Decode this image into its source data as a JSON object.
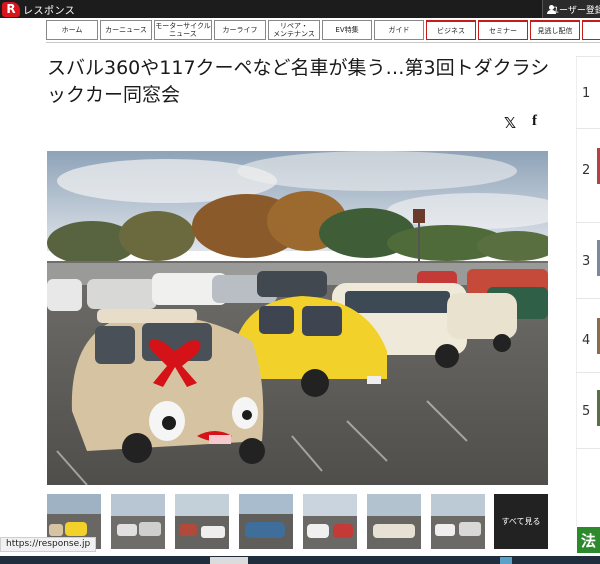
{
  "header": {
    "site_name": "レスポンス",
    "logo_letter": "R",
    "user_menu": "ユーザー登録"
  },
  "nav": {
    "items": [
      {
        "label": "ホーム",
        "accent": false
      },
      {
        "label": "カーニュース",
        "accent": false
      },
      {
        "label": "モーターサイクル\nニュース",
        "accent": false
      },
      {
        "label": "カーライフ",
        "accent": false
      },
      {
        "label": "リペア・\nメンテナンス",
        "accent": false
      },
      {
        "label": "EV特集",
        "accent": false
      },
      {
        "label": "ガイド",
        "accent": false
      },
      {
        "label": "ビジネス",
        "accent": true
      },
      {
        "label": "セミナー",
        "accent": true
      },
      {
        "label": "見逃し配信",
        "accent": true
      }
    ]
  },
  "article": {
    "title": "スバル360や117クーペなど名車が集う…第3回トダクラシックカー同窓会",
    "share_x": "𝕏",
    "share_facebook": "f"
  },
  "gallery": {
    "see_all": "すべて見る"
  },
  "ranking": {
    "numbers": [
      "1",
      "2",
      "3",
      "4",
      "5"
    ]
  },
  "ad": {
    "label": "法"
  },
  "status_bar": {
    "url": "https://response.jp"
  },
  "colors": {
    "brand_red": "#d8141c",
    "accent_red": "#c41b1b",
    "topbar": "#1c1c1c"
  }
}
